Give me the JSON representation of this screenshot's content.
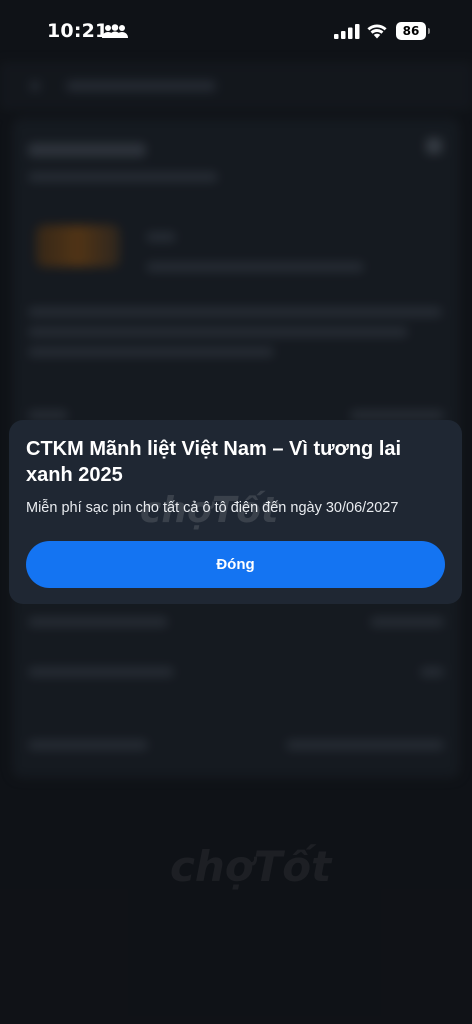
{
  "status_bar": {
    "time": "10:21",
    "battery": "86"
  },
  "popup": {
    "title": "CTKM Mãnh liệt Việt Nam – Vì tương lai xanh 2025",
    "description": "Miễn phí sạc pin cho tất cả ô tô điện đến ngày 30/06/2027",
    "close_label": "Đóng"
  },
  "watermark": "chợTốt",
  "colors": {
    "background": "#17191f",
    "popup": "#1f2733",
    "button": "#1474f2"
  }
}
